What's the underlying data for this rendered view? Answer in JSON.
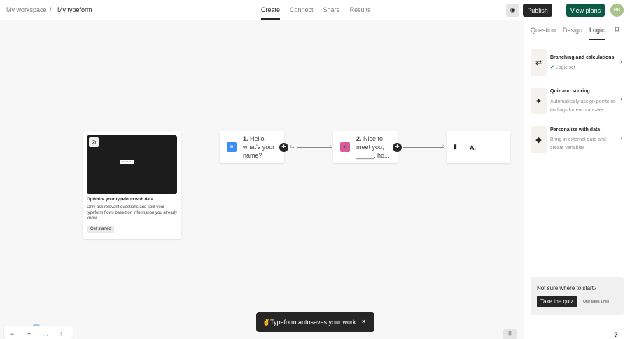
{
  "header": {
    "workspace": "My workspace",
    "separator": "/",
    "form_name": "My typeform",
    "tabs": [
      "Create",
      "Connect",
      "Share",
      "Results"
    ],
    "publish": "Publish",
    "view_plans": "View plans",
    "avatar": "BB"
  },
  "sidebar": {
    "tabs": [
      "Question",
      "Design",
      "Logic"
    ],
    "options": [
      {
        "title": "Branching and calculations",
        "desc": "Logic set",
        "icon": "branch-icon"
      },
      {
        "title": "Quiz and scoring",
        "desc": "Automatically assign points or endings for each answer",
        "icon": "sparkle-icon"
      },
      {
        "title": "Personalize with data",
        "desc": "Bring in external data and create variables",
        "icon": "tag-icon"
      }
    ],
    "quiz": {
      "prompt": "Not sure where to start?",
      "button": "Take the quiz",
      "note": "Only takes 1 min"
    },
    "help": "?"
  },
  "promo": {
    "badge": "product_id ×",
    "title": "Optimize your typeform with data",
    "desc": "Only ask relevant questions and split your typeform flows based on information you already know",
    "button": "Get started"
  },
  "nodes": [
    {
      "num": "1.",
      "text": "Hello, what's your name?",
      "color": "#3d8df5"
    },
    {
      "num": "2.",
      "text": "Nice to meet you, _____, ho...",
      "color": "#d65c99"
    },
    {
      "num": "",
      "text": "A.",
      "color": "#262627"
    }
  ],
  "toast": {
    "emoji": "✌",
    "text": "Typeform autosaves your work",
    "close": "×"
  },
  "zoom_controls": {
    "minus": "−",
    "plus": "+"
  }
}
